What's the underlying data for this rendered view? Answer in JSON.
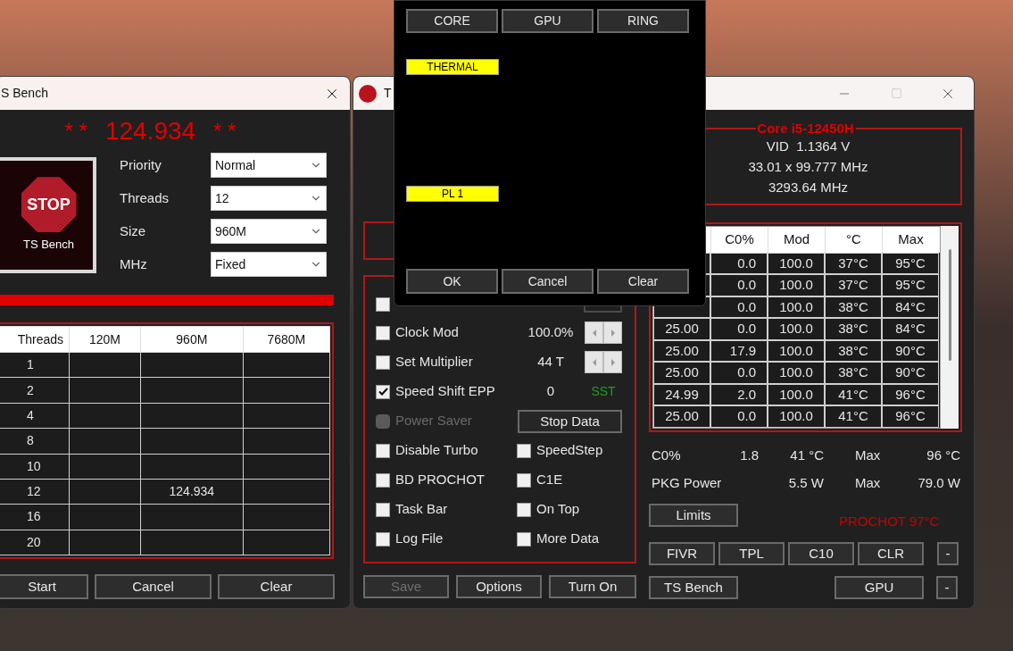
{
  "bench_window": {
    "title": "S Bench",
    "score_marks_left": "* *",
    "score": "124.934",
    "score_marks_right": "* *",
    "logo": {
      "sign": "STOP",
      "caption": "TS Bench"
    },
    "settings": [
      {
        "label": "Priority",
        "value": "Normal"
      },
      {
        "label": "Threads",
        "value": "12"
      },
      {
        "label": "Size",
        "value": "960M"
      },
      {
        "label": "MHz",
        "value": "Fixed"
      }
    ],
    "progress": {
      "level": 1
    },
    "table": {
      "columns": [
        "Threads",
        "120M",
        "960M",
        "7680M"
      ],
      "rows": [
        [
          "1",
          "",
          "",
          ""
        ],
        [
          "2",
          "",
          "",
          ""
        ],
        [
          "4",
          "",
          "",
          ""
        ],
        [
          "8",
          "",
          "",
          ""
        ],
        [
          "10",
          "",
          "",
          ""
        ],
        [
          "12",
          "",
          "124.934",
          ""
        ],
        [
          "16",
          "",
          "",
          ""
        ],
        [
          "20",
          "",
          "",
          ""
        ]
      ]
    },
    "buttons": [
      "Start",
      "Cancel",
      "Clear"
    ]
  },
  "main_window": {
    "title": "T",
    "options": [
      {
        "left": {
          "kind": "checkbox",
          "checked": false,
          "disabled": false
        },
        "right": {
          "kind": "blank"
        }
      },
      {
        "left": {
          "kind": "checkbox",
          "label": "Clock Mod",
          "checked": false,
          "disabled": false
        },
        "value": "100.0%",
        "right": {
          "kind": "spinner"
        }
      },
      {
        "left": {
          "kind": "checkbox",
          "label": "Set Multiplier",
          "checked": false,
          "disabled": false
        },
        "value": "44 T",
        "right": {
          "kind": "spinner"
        }
      },
      {
        "left": {
          "kind": "checkbox",
          "label": "Speed Shift EPP",
          "checked": true,
          "disabled": false
        },
        "value": "0",
        "right": {
          "kind": "status",
          "label": "SST"
        }
      },
      {
        "left": {
          "kind": "checkbox",
          "label": "Power Saver",
          "checked": false,
          "disabled": true
        },
        "right": {
          "kind": "button",
          "label": "Stop Data"
        }
      },
      {
        "left": {
          "kind": "checkbox",
          "label": "Disable Turbo",
          "checked": false,
          "disabled": false
        },
        "right": {
          "kind": "checkbox",
          "label": "SpeedStep",
          "checked": false
        }
      },
      {
        "left": {
          "kind": "checkbox",
          "label": "BD PROCHOT",
          "checked": false,
          "disabled": false
        },
        "right": {
          "kind": "checkbox",
          "label": "C1E",
          "checked": false
        }
      },
      {
        "left": {
          "kind": "checkbox",
          "label": "Task Bar",
          "checked": false,
          "disabled": false
        },
        "right": {
          "kind": "checkbox",
          "label": "On Top",
          "checked": false
        }
      },
      {
        "left": {
          "kind": "checkbox",
          "label": "Log File",
          "checked": false,
          "disabled": false
        },
        "right": {
          "kind": "checkbox",
          "label": "More Data",
          "checked": false
        }
      }
    ],
    "bottom_buttons": [
      {
        "label": "Save",
        "disabled": true
      },
      {
        "label": "Options",
        "disabled": false
      },
      {
        "label": "Turn On",
        "disabled": false
      }
    ],
    "cpu": {
      "name": "Core i5-12450H",
      "lines": [
        "VID  1.1364 V",
        "33.01 x 99.777 MHz",
        "3293.64 MHz"
      ]
    },
    "core_table": {
      "columns": [
        "C0%",
        "Mod",
        "°C",
        "Max"
      ],
      "rows": [
        {
          "c0": "0.0",
          "mod": "100.0",
          "temp": "37°C",
          "max": "95°C"
        },
        {
          "c0": "0.0",
          "mod": "100.0",
          "temp": "37°C",
          "max": "95°C"
        },
        {
          "c0": "0.0",
          "mod": "100.0",
          "temp": "38°C",
          "max": "84°C"
        },
        {
          "column_1": "25.00",
          "c0": "0.0",
          "mod": "100.0",
          "temp": "38°C",
          "max": "84°C"
        },
        {
          "column_1": "25.00",
          "c0": "17.9",
          "mod": "100.0",
          "temp": "38°C",
          "max": "90°C"
        },
        {
          "column_1": "25.00",
          "c0": "0.0",
          "mod": "100.0",
          "temp": "38°C",
          "max": "90°C"
        },
        {
          "column_1": "24.99",
          "c0": "2.0",
          "mod": "100.0",
          "temp": "41°C",
          "max": "96°C"
        },
        {
          "column_1": "25.00",
          "c0": "0.0",
          "mod": "100.0",
          "temp": "41°C",
          "max": "96°C"
        }
      ]
    },
    "stats": [
      {
        "label": "C0%",
        "value": "1.8",
        "current": "41 °C",
        "max_label": "Max",
        "max": "96 °C"
      },
      {
        "label": "PKG Power",
        "current": "5.5 W",
        "max_label": "Max",
        "max": "79.0 W"
      }
    ],
    "limits_button": "Limits",
    "prochot": "PROCHOT 97°C",
    "tool_buttons": [
      "FIVR",
      "TPL",
      "C10",
      "CLR"
    ],
    "tool_toggle": "-",
    "bench_button": "TS Bench",
    "gpu_button": "GPU",
    "gpu_toggle": "-"
  },
  "limits_popup": {
    "tabs": [
      "CORE",
      "GPU",
      "RING"
    ],
    "labels": [
      "THERMAL",
      "PL 1"
    ],
    "buttons": [
      "OK",
      "Cancel",
      "Clear"
    ]
  }
}
